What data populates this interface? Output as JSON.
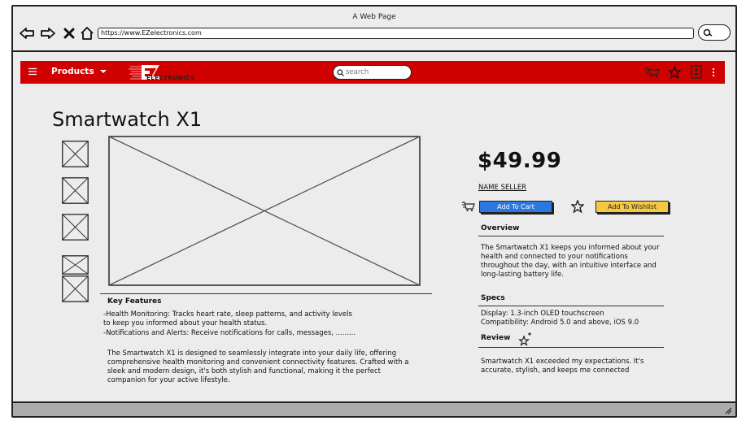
{
  "browser": {
    "title": "A Web Page",
    "url": "https://www.EZelectronics.com"
  },
  "navbar": {
    "products_label": "Products",
    "logo_text": "ELECTRONICS",
    "search_placeholder": "search",
    "color": "#d10000"
  },
  "product": {
    "title": "Smartwatch X1",
    "price": "$49.99",
    "seller": "NAME SELLER",
    "add_to_cart": "Add To Cart",
    "add_to_wishlist": "Add To Wishlist"
  },
  "overview": {
    "heading": "Overview",
    "text": "The Smartwatch X1 keeps you informed about your health and connected to your notifications throughout the day, with an intuitive interface and long-lasting battery life."
  },
  "specs": {
    "heading": "Specs",
    "lines": [
      "Display: 1.3-inch OLED touchscreen",
      "Compatibility: Android 5.0 and above, iOS 9.0"
    ]
  },
  "review": {
    "heading": "Review",
    "text": "Smartwatch X1 exceeded my expectations. It's accurate, stylish, and keeps me connected"
  },
  "key_features": {
    "heading": "Key Features",
    "line1": "-Health Monitoring: Tracks heart rate, sleep patterns, and activity levels",
    "line2": "to keep you informed about your health status.",
    "line3": "-Notifications and Alerts: Receive notifications for calls, messages, .........",
    "description": "The Smartwatch X1 is designed to seamlessly integrate into your daily life, offering comprehensive health monitoring and convenient connectivity features. Crafted with a sleek and modern design, it's both stylish and functional, making it the perfect companion for your active lifestyle."
  }
}
